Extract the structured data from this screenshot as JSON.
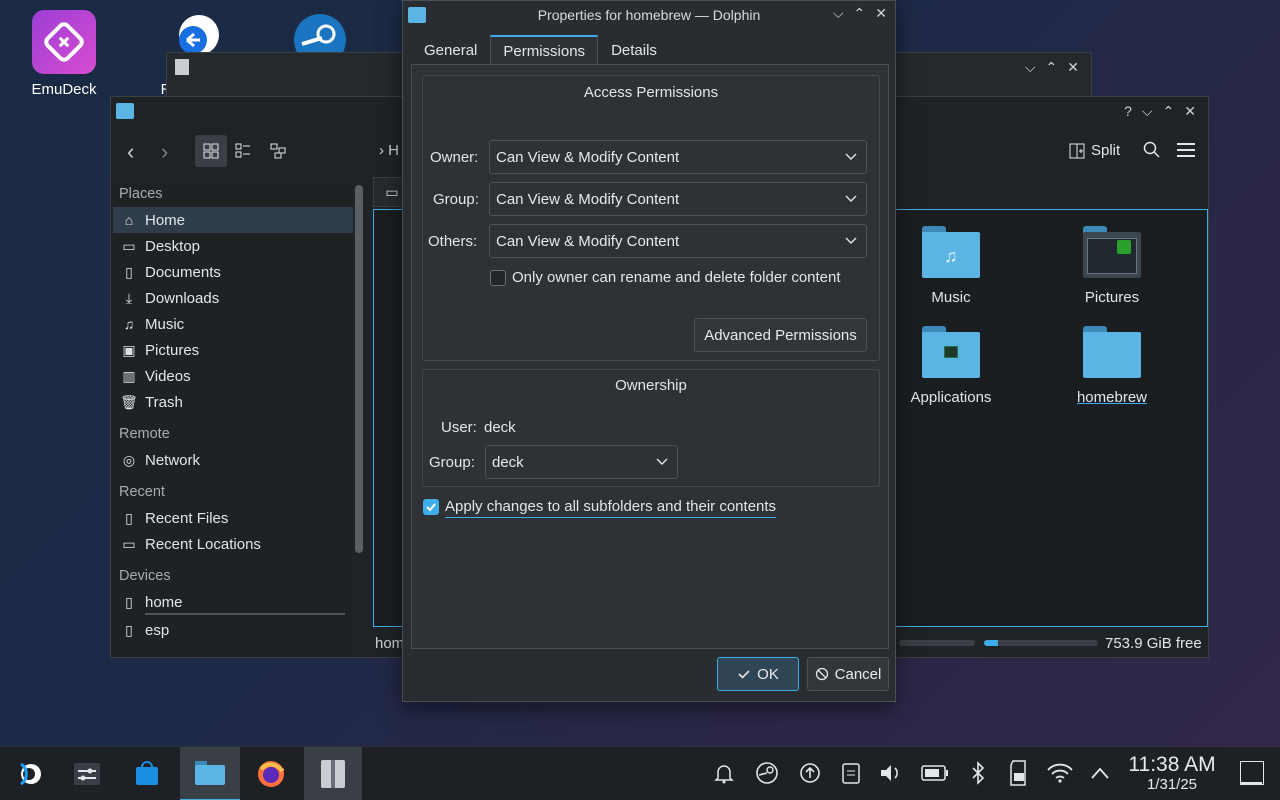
{
  "desktop": {
    "icons": [
      {
        "label": "EmuDeck"
      },
      {
        "label": "R"
      }
    ]
  },
  "dolphin": {
    "sidebar": {
      "places_heading": "Places",
      "places": [
        "Home",
        "Desktop",
        "Documents",
        "Downloads",
        "Music",
        "Pictures",
        "Videos",
        "Trash"
      ],
      "remote_heading": "Remote",
      "remote": [
        "Network"
      ],
      "recent_heading": "Recent",
      "recent": [
        "Recent Files",
        "Recent Locations"
      ],
      "devices_heading": "Devices",
      "devices": [
        "home",
        "esp"
      ]
    },
    "toolbar": {
      "split_label": "Split",
      "breadcrumb_partial": "H"
    },
    "files": [
      {
        "label": "Music"
      },
      {
        "label": "Pictures"
      },
      {
        "label": "Applications"
      },
      {
        "label": "homebrew"
      }
    ],
    "status": {
      "path_partial": "hom",
      "free_space": "753.9 GiB free",
      "free_fraction": 0.12
    }
  },
  "dialog": {
    "title": "Properties for homebrew — Dolphin",
    "tabs": [
      "General",
      "Permissions",
      "Details"
    ],
    "active_tab": "Permissions",
    "access": {
      "heading": "Access Permissions",
      "owner_label": "Owner:",
      "owner_value": "Can View & Modify Content",
      "group_label": "Group:",
      "group_value": "Can View & Modify Content",
      "others_label": "Others:",
      "others_value": "Can View & Modify Content",
      "only_owner_label": "Only owner can rename and delete folder content",
      "only_owner_checked": false,
      "advanced_button": "Advanced Permissions"
    },
    "ownership": {
      "heading": "Ownership",
      "user_label": "User:",
      "user_value": "deck",
      "group_label": "Group:",
      "group_value": "deck"
    },
    "apply_label": "Apply changes to all subfolders and their contents",
    "apply_checked": true,
    "ok_label": "OK",
    "cancel_label": "Cancel"
  },
  "taskbar": {
    "clock_time": "11:38 AM",
    "clock_date": "1/31/25"
  },
  "colors": {
    "accent": "#3daee9",
    "folder": "#5bb5e4",
    "window_bg": "#202326",
    "dialog_bg": "#292c30"
  }
}
